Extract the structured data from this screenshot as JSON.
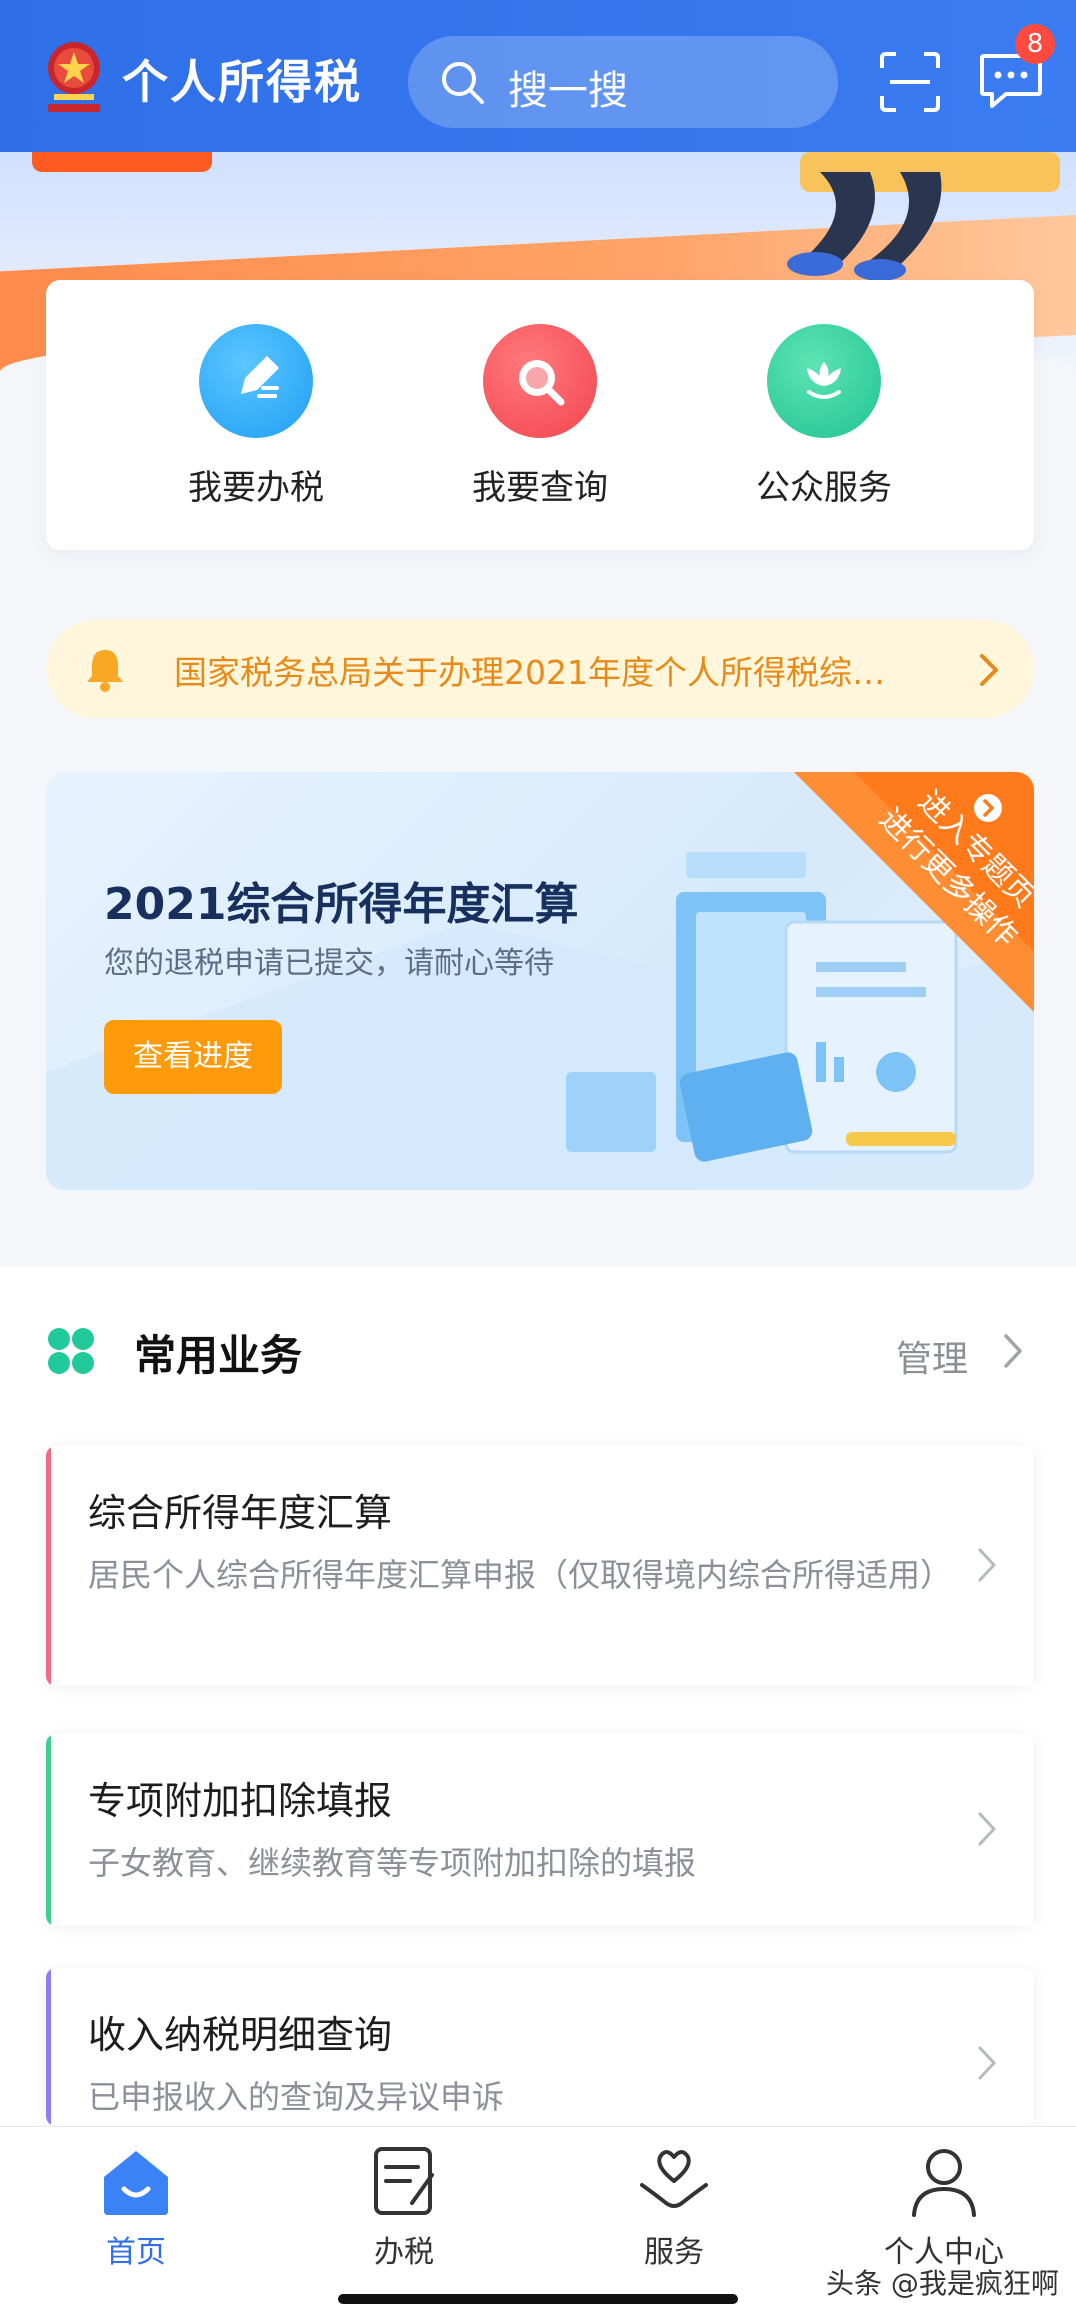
{
  "header": {
    "app_title": "个人所得税",
    "search_placeholder": "搜一搜",
    "message_badge": "8"
  },
  "quick_actions": [
    {
      "label": "我要办税",
      "icon": "pencil-icon",
      "color": "#1f9ef5"
    },
    {
      "label": "我要查询",
      "icon": "magnifier-icon",
      "color": "#f2434c"
    },
    {
      "label": "公众服务",
      "icon": "lotus-icon",
      "color": "#1ec48f"
    }
  ],
  "notice": {
    "text": "国家税务总局关于办理2021年度个人所得税综…"
  },
  "promo": {
    "title": "2021综合所得年度汇算",
    "subtitle": "您的退税申请已提交，请耐心等待",
    "button": "查看进度",
    "corner_line1": "进入专题页",
    "corner_line2": "进行更多操作"
  },
  "section": {
    "title": "常用业务",
    "manage": "管理",
    "items": [
      {
        "title": "综合所得年度汇算",
        "desc": "居民个人综合所得年度汇算申报（仅取得境内综合所得适用）",
        "accent": "#f06a86"
      },
      {
        "title": "专项附加扣除填报",
        "desc": "子女教育、继续教育等专项附加扣除的填报",
        "accent": "#3fcf8e"
      },
      {
        "title": "收入纳税明细查询",
        "desc": "已申报收入的查询及异议申诉",
        "accent": "#8e7cf0"
      }
    ]
  },
  "tabbar": {
    "tabs": [
      {
        "label": "首页",
        "icon": "home-icon",
        "active": true
      },
      {
        "label": "办税",
        "icon": "document-icon",
        "active": false
      },
      {
        "label": "服务",
        "icon": "heart-hand-icon",
        "active": false
      },
      {
        "label": "个人中心",
        "icon": "user-icon",
        "active": false
      }
    ]
  },
  "watermark": "头条 @我是疯狂啊",
  "colors": {
    "primary": "#2f6fe8",
    "notice_text": "#e88a18",
    "promo_button": "#ff9a0a"
  }
}
